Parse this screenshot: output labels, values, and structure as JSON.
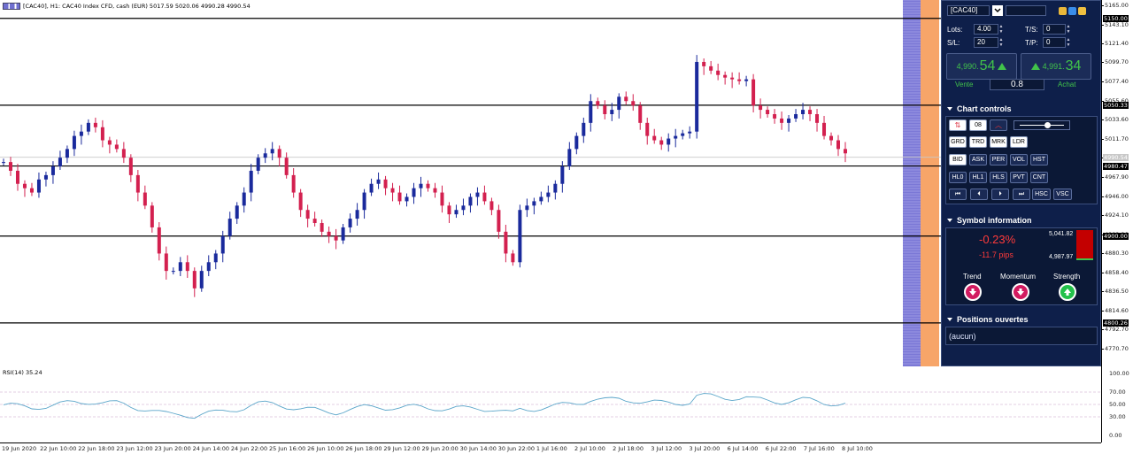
{
  "chart": {
    "title": "[CAC40], H1:  CAC40 Index CFD, cash (EUR)  5017.59 5020.06 4990.28 4990.54",
    "rsi_title": "RSI(14) 35.24",
    "price_ticks": [
      "5165.00",
      "5143.10",
      "5121.40",
      "5099.70",
      "5077.40",
      "5055.60",
      "5033.60",
      "5011.70",
      "4989.80",
      "4967.90",
      "4946.00",
      "4924.10",
      "4902.20",
      "4880.30",
      "4858.40",
      "4836.50",
      "4814.60",
      "4792.70",
      "4770.70"
    ],
    "price_tags": {
      "line1": "5150.00",
      "line2": "5050.33",
      "current": "4990.54",
      "line3": "4980.47",
      "line4": "4900.00",
      "line5": "4800.26"
    },
    "rsi_ticks": [
      "100.00",
      "70.00",
      "50.00",
      "30.00",
      "0.00"
    ],
    "time_labels": [
      "19 Jun 2020",
      "22 Jun 10:00",
      "22 Jun 18:00",
      "23 Jun 12:00",
      "23 Jun 20:00",
      "24 Jun 14:00",
      "24 Jun 22:00",
      "25 Jun 16:00",
      "26 Jun 10:00",
      "26 Jun 18:00",
      "29 Jun 12:00",
      "29 Jun 20:00",
      "30 Jun 14:00",
      "30 Jun 22:00",
      "1 Jul 16:00",
      "2 Jul 10:00",
      "2 Jul 18:00",
      "3 Jul 12:00",
      "3 Jul 20:00",
      "6 Jul 14:00",
      "6 Jul 22:00",
      "7 Jul 16:00",
      "8 Jul 10:00"
    ],
    "colors": {
      "bull": "#1a2a9c",
      "bear": "#d3204f",
      "rsi": "#5aa5c9"
    }
  },
  "panel": {
    "symbol": "[CAC40]",
    "lots_label": "Lots:",
    "lots_value": "4.00",
    "ts_label": "T/S:",
    "ts_value": "0",
    "sl_label": "S/L:",
    "sl_value": "20",
    "tp_label": "T/P:",
    "tp_value": "0",
    "sell_small": "4,990.",
    "sell_big": "54",
    "buy_small": "4,991.",
    "buy_big": "34",
    "sell_label": "Vente",
    "buy_label": "Achat",
    "spread": "0.8",
    "chart_controls_title": "Chart controls",
    "zoom_value": "08",
    "row1": [
      "GRD",
      "TRD",
      "MRK",
      "LDR"
    ],
    "row2": [
      "BID",
      "ASK",
      "PER",
      "VOL",
      "HST"
    ],
    "row3": [
      "HL0",
      "HL1",
      "HLS",
      "PVT",
      "CNT"
    ],
    "row4": [
      "HSC",
      "VSC"
    ],
    "symbol_info_title": "Symbol information",
    "change_pct": "-0.23%",
    "change_pips": "-11.7 pips",
    "high_val": "5,041.82",
    "low_val": "4,987.97",
    "trend_label": "Trend",
    "momentum_label": "Momentum",
    "strength_label": "Strength",
    "positions_title": "Positions ouvertes",
    "positions_value": "(aucun)"
  }
}
